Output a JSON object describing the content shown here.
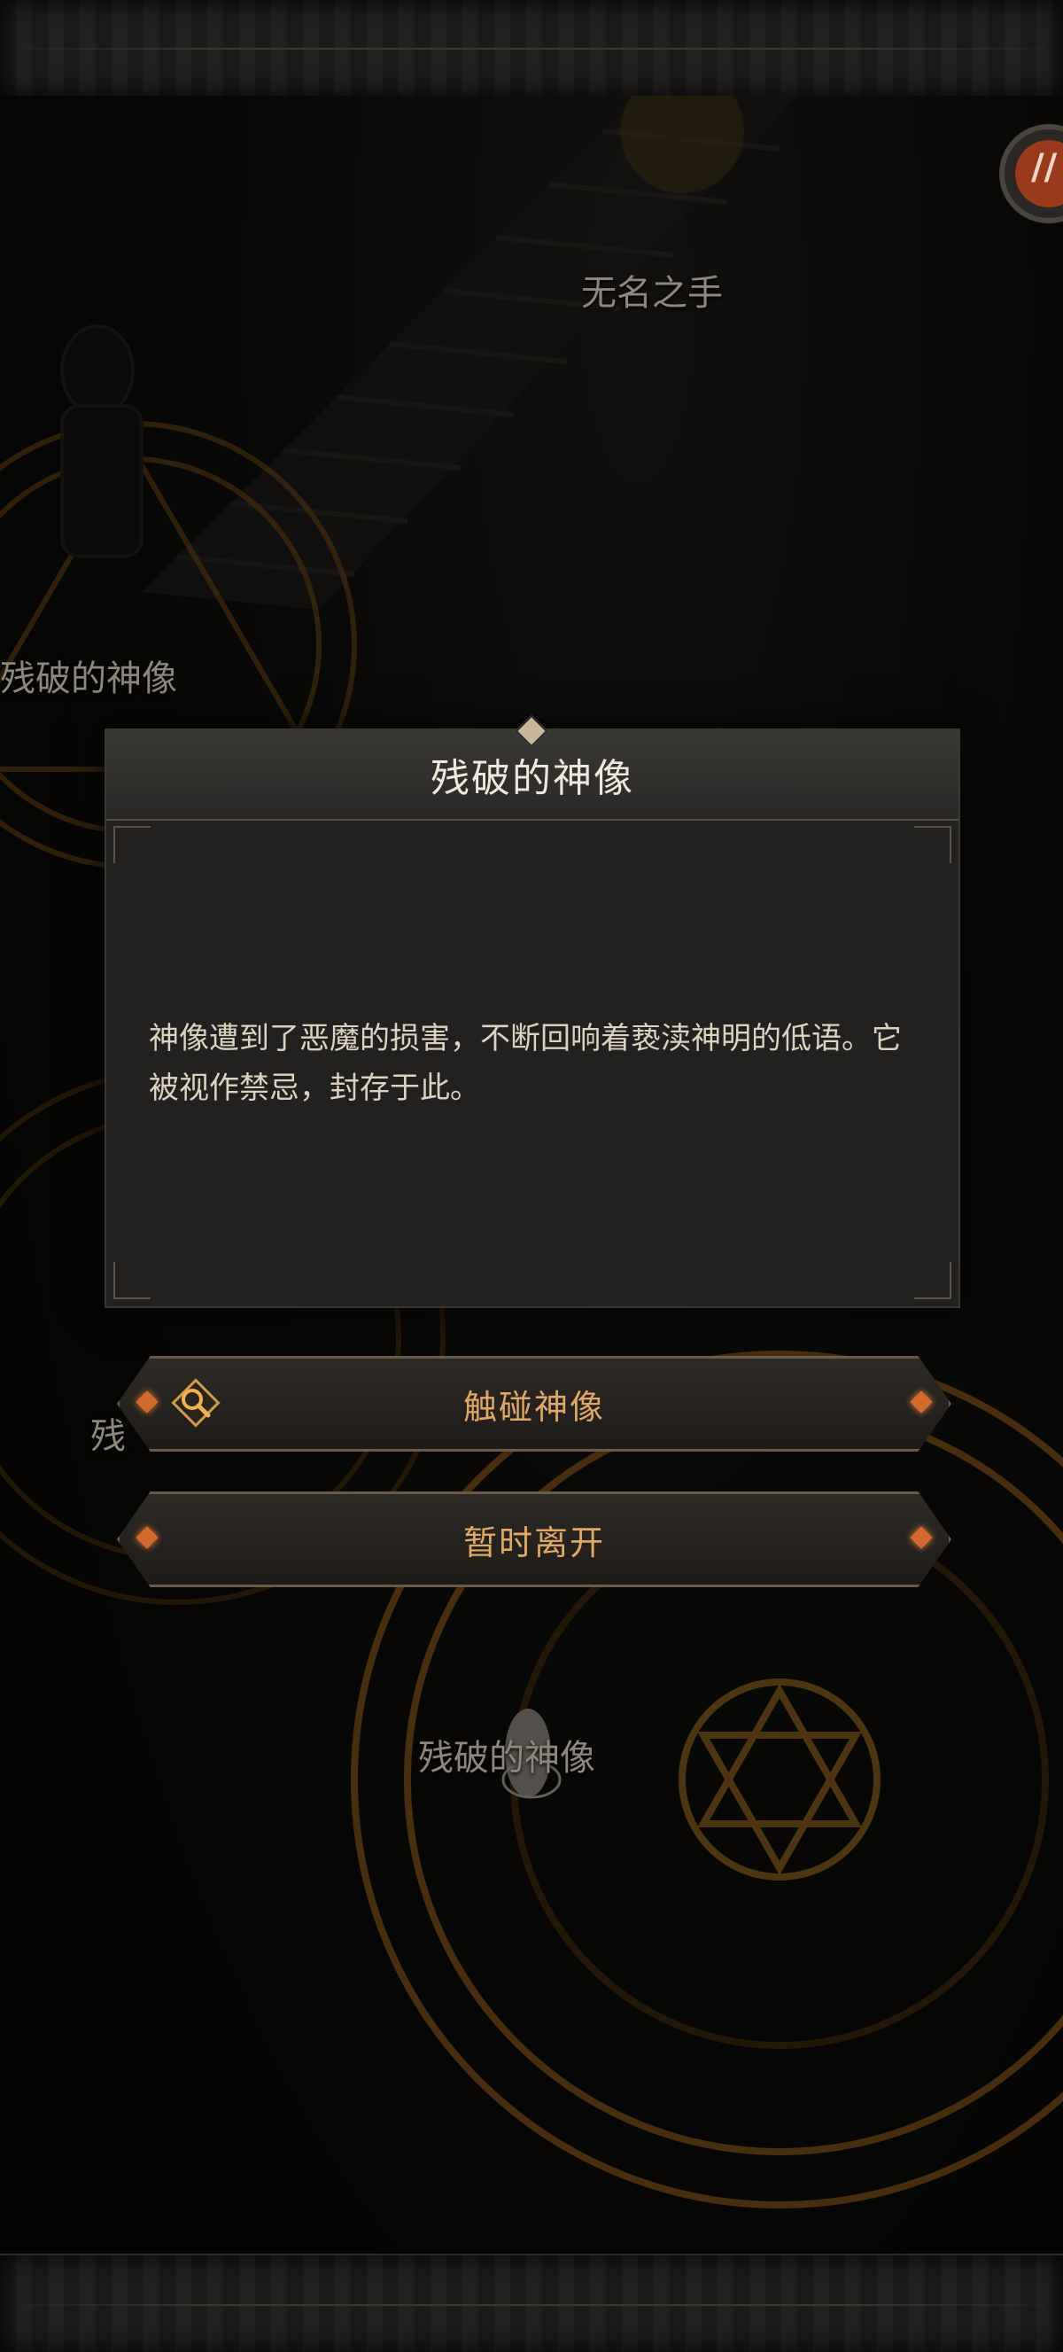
{
  "scene": {
    "labels": {
      "nameless_hand": "无名之手",
      "statue_left": "残破的神像",
      "statue_mid": "残",
      "statue_bottom": "残破的神像"
    }
  },
  "dialog": {
    "title": "残破的神像",
    "body": "神像遭到了恶魔的损害，不断回响着亵渎神明的低语。它被视作禁忌，封存于此。"
  },
  "actions": {
    "touch_label": "触碰神像",
    "leave_label": "暂时离开"
  },
  "colors": {
    "accent": "#e0a866",
    "gem": "#d2692e",
    "panel": "#222120"
  },
  "icons": {
    "record": "record-icon",
    "search": "search-icon"
  }
}
